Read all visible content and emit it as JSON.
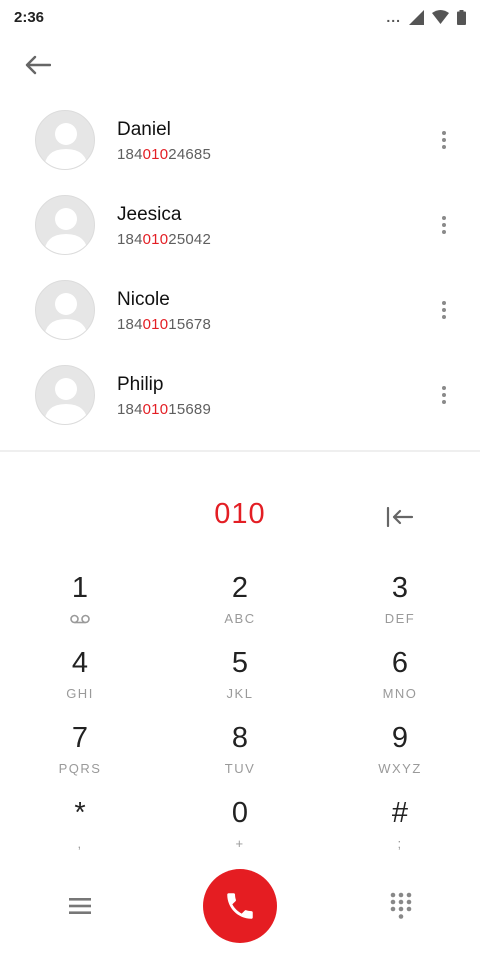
{
  "status_bar": {
    "time": "2:36",
    "dots": "..."
  },
  "contacts": [
    {
      "name": "Daniel",
      "number_prefix": "184",
      "number_match": "010",
      "number_suffix": "24685"
    },
    {
      "name": "Jeesica",
      "number_prefix": "184",
      "number_match": "010",
      "number_suffix": "25042"
    },
    {
      "name": "Nicole",
      "number_prefix": "184",
      "number_match": "010",
      "number_suffix": "15678"
    },
    {
      "name": "Philip",
      "number_prefix": "184",
      "number_match": "010",
      "number_suffix": "15689"
    }
  ],
  "dialer": {
    "digits": "010"
  },
  "keypad": {
    "k1": {
      "digit": "1",
      "letters": ""
    },
    "k2": {
      "digit": "2",
      "letters": "ABC"
    },
    "k3": {
      "digit": "3",
      "letters": "DEF"
    },
    "k4": {
      "digit": "4",
      "letters": "GHI"
    },
    "k5": {
      "digit": "5",
      "letters": "JKL"
    },
    "k6": {
      "digit": "6",
      "letters": "MNO"
    },
    "k7": {
      "digit": "7",
      "letters": "PQRS"
    },
    "k8": {
      "digit": "8",
      "letters": "TUV"
    },
    "k9": {
      "digit": "9",
      "letters": "WXYZ"
    },
    "kstar": {
      "digit": "*",
      "letters": ","
    },
    "k0": {
      "digit": "0",
      "letters": "+"
    },
    "khash": {
      "digit": "#",
      "letters": ";"
    }
  },
  "icons": {
    "back": "arrow-left-icon",
    "more": "more-vert-icon",
    "backspace": "backspace-icon",
    "voicemail": "voicemail-icon",
    "menu": "menu-icon",
    "call": "phone-icon",
    "dialpad": "dialpad-icon"
  },
  "colors": {
    "accent": "#e31e24",
    "call_button": "#e51d22"
  }
}
